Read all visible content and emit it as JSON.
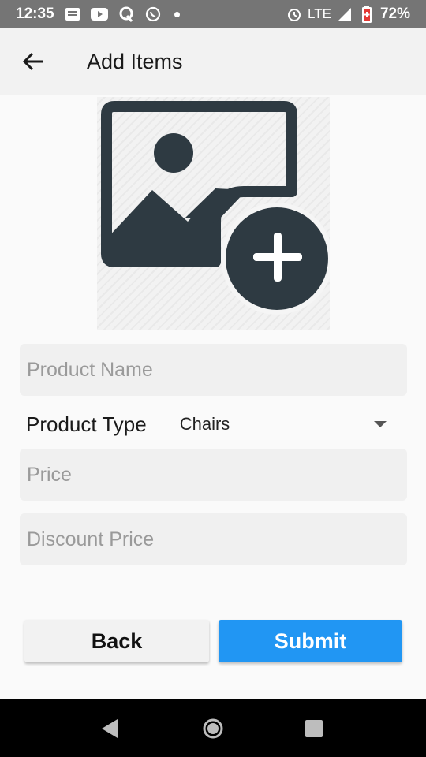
{
  "status_bar": {
    "time": "12:35",
    "network": "LTE",
    "battery": "72%",
    "left_icons": [
      "message-icon",
      "youtube-icon",
      "quora-icon",
      "whatsapp-icon",
      "dot-icon"
    ],
    "right_icons": [
      "alarm-icon",
      "signal-icon",
      "battery-icon"
    ]
  },
  "app_bar": {
    "title": "Add Items"
  },
  "image_picker": {
    "icon": "add-photo-icon",
    "icon_color": "#2e3a42"
  },
  "form": {
    "product_name_placeholder": "Product Name",
    "product_type_label": "Product Type",
    "product_type_value": "Chairs",
    "price_placeholder": "Price",
    "discount_price_placeholder": "Discount Price"
  },
  "buttons": {
    "back_label": "Back",
    "submit_label": "Submit"
  },
  "colors": {
    "accent": "#2196f3",
    "status_bar": "#757575",
    "app_bar": "#f2f2f2"
  }
}
